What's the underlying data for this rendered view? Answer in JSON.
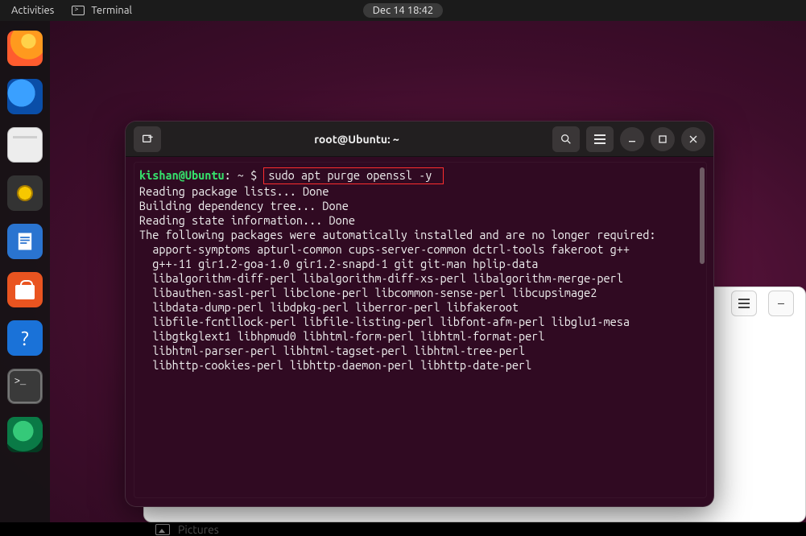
{
  "topbar": {
    "activities": "Activities",
    "app_label": "Terminal",
    "clock": "Dec 14  18:42"
  },
  "dock": {
    "items": [
      {
        "name": "firefox"
      },
      {
        "name": "thunderbird"
      },
      {
        "name": "files"
      },
      {
        "name": "rhythmbox"
      },
      {
        "name": "libreoffice-writer"
      },
      {
        "name": "ubuntu-software"
      },
      {
        "name": "help"
      },
      {
        "name": "terminal"
      },
      {
        "name": "web-globe"
      }
    ]
  },
  "files_window": {
    "sidebar_item": "Pictures"
  },
  "terminal": {
    "title": "root@Ubuntu: ~",
    "prompt": {
      "user": "kishan",
      "host": "Ubuntu",
      "path": "~",
      "symbol": "$"
    },
    "command": "sudo apt purge openssl -y",
    "output_lines": [
      "Reading package lists... Done",
      "Building dependency tree... Done",
      "Reading state information... Done",
      "The following packages were automatically installed and are no longer required:",
      "  apport-symptoms apturl-common cups-server-common dctrl-tools fakeroot g++",
      "  g++-11 gir1.2-goa-1.0 gir1.2-snapd-1 git git-man hplip-data",
      "  libalgorithm-diff-perl libalgorithm-diff-xs-perl libalgorithm-merge-perl",
      "  libauthen-sasl-perl libclone-perl libcommon-sense-perl libcupsimage2",
      "  libdata-dump-perl libdpkg-perl liberror-perl libfakeroot",
      "  libfile-fcntllock-perl libfile-listing-perl libfont-afm-perl libglu1-mesa",
      "  libgtkglext1 libhpmud0 libhtml-form-perl libhtml-format-perl",
      "  libhtml-parser-perl libhtml-tagset-perl libhtml-tree-perl",
      "  libhttp-cookies-perl libhttp-daemon-perl libhttp-date-perl"
    ]
  },
  "colors": {
    "prompt_green": "#35e06b",
    "highlight_red": "#ff2e2e",
    "terminal_bg": "#300a22"
  }
}
